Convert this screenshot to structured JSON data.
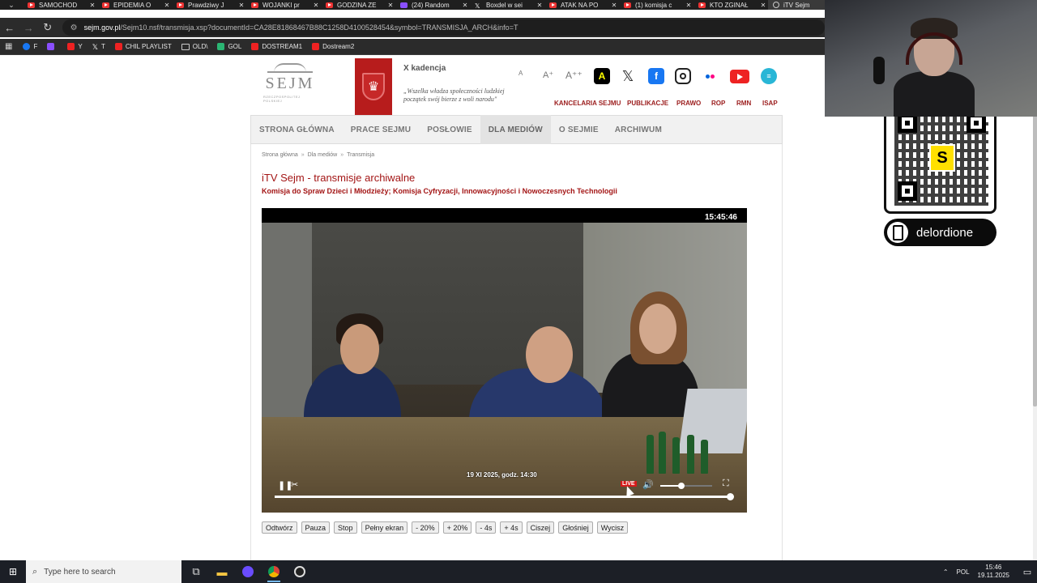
{
  "browser": {
    "tabs": [
      {
        "label": "SAMOCHOD",
        "icon": "youtube"
      },
      {
        "label": "EPIDEMIA O",
        "icon": "youtube"
      },
      {
        "label": "Prawdziwy J",
        "icon": "youtube"
      },
      {
        "label": "WOJANKI pr",
        "icon": "youtube"
      },
      {
        "label": "GODZINA ZE",
        "icon": "youtube"
      },
      {
        "label": "(24) Random",
        "icon": "twitch"
      },
      {
        "label": "Boxdel w sei",
        "icon": "x"
      },
      {
        "label": "ATAK NA PO",
        "icon": "youtube"
      },
      {
        "label": "(1) komisja c",
        "icon": "youtube"
      },
      {
        "label": "KTO ZGINAŁ",
        "icon": "youtube"
      },
      {
        "label": "iTV Sejm",
        "icon": "web",
        "active": true
      }
    ],
    "close_glyph": "✕",
    "url": {
      "domain": "sejm.gov.pl",
      "path": "/Sejm10.nsf/transmisja.xsp?documentId=CA28E81868467B88C1258D4100528454&symbol=TRANSMISJA_ARCH&info=T"
    },
    "bookmarks": [
      {
        "label": "F",
        "icon": "facebook"
      },
      {
        "label": "",
        "icon": "twitch"
      },
      {
        "label": "Y",
        "icon": "youtube"
      },
      {
        "label": "T",
        "icon": "x"
      },
      {
        "label": "CHIL PLAYLIST",
        "icon": "youtube"
      },
      {
        "label": "OLD\\",
        "icon": "folder"
      },
      {
        "label": "GOL",
        "icon": "gol"
      },
      {
        "label": "DOSTREAM1",
        "icon": "youtube"
      },
      {
        "label": "Dostream2",
        "icon": "youtube"
      }
    ]
  },
  "site": {
    "logo_text": "SEJM",
    "logo_sub": "RZECZPOSPOLITEJ POLSKIEJ",
    "kadencja": "X kadencja",
    "motto": "„Wszelka władza społeczności ludzkiej początek swój bierze z woli narodu\"",
    "font_sizes": [
      "A",
      "A⁺",
      "A⁺⁺"
    ],
    "social": [
      "A",
      "X",
      "f",
      "instagram",
      "flickr",
      "youtube",
      "ipla"
    ],
    "top_links": [
      "KANCELARIA SEJMU",
      "PUBLIKACJE",
      "PRAWO",
      "ROP",
      "RMN",
      "ISAP"
    ],
    "nav": [
      {
        "label": "STRONA GŁÓWNA"
      },
      {
        "label": "PRACE SEJMU"
      },
      {
        "label": "POSŁOWIE"
      },
      {
        "label": "DLA MEDIÓW",
        "active": true
      },
      {
        "label": "O SEJMIE"
      },
      {
        "label": "ARCHIWUM"
      }
    ],
    "breadcrumb": [
      "Strona główna",
      "Dla mediów",
      "Transmisja"
    ],
    "breadcrumb_sep": "»",
    "title": "iTV Sejm - transmisje archiwalne",
    "subtitle": "Komisja do Spraw Dzieci i Młodzieży; Komisja Cyfryzacji, Innowacyjności i Nowoczesnych Technologii"
  },
  "video": {
    "time": "15:45:46",
    "date_caption": "19 XI 2025, godz. 14:30",
    "live_label": "LIVE",
    "volume_level": 0.4,
    "progress": 1.0
  },
  "player_buttons": [
    "Odtwórz",
    "Pauza",
    "Stop",
    "Pełny ekran",
    "- 20%",
    "+ 20%",
    "- 4s",
    "+ 4s",
    "Ciszej",
    "Głośniej",
    "Wycisz"
  ],
  "overlay": {
    "handle": "delordione",
    "qr_logo": "S"
  },
  "taskbar": {
    "search_placeholder": "Type here to search",
    "lang": "POL",
    "time": "15:46",
    "date": "19.11.2025"
  }
}
